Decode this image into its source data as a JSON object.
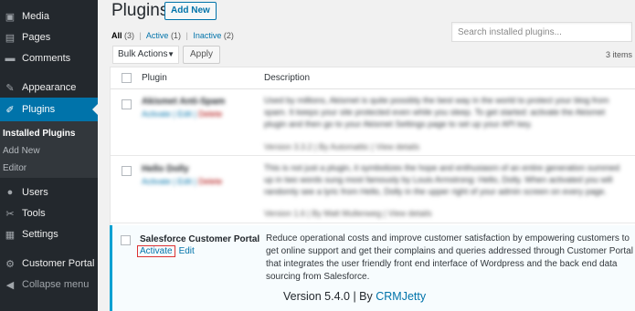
{
  "sidebar": {
    "items": [
      {
        "label": "Media",
        "icon": "media-icon",
        "glyph": "▣"
      },
      {
        "label": "Pages",
        "icon": "pages-icon",
        "glyph": "▤"
      },
      {
        "label": "Comments",
        "icon": "comments-icon",
        "glyph": "▬"
      },
      {
        "label": "Appearance",
        "icon": "appearance-icon",
        "glyph": "✎"
      },
      {
        "label": "Plugins",
        "icon": "plugins-icon",
        "glyph": "✐"
      },
      {
        "label": "Users",
        "icon": "users-icon",
        "glyph": "●"
      },
      {
        "label": "Tools",
        "icon": "tools-icon",
        "glyph": "✂"
      },
      {
        "label": "Settings",
        "icon": "settings-icon",
        "glyph": "▦"
      },
      {
        "label": "Customer Portal",
        "icon": "customer-portal-icon",
        "glyph": "⚙"
      },
      {
        "label": "Collapse menu",
        "icon": "collapse-icon",
        "glyph": "◀"
      }
    ],
    "submenu": [
      "Installed Plugins",
      "Add New",
      "Editor"
    ],
    "active_color": "#0073aa"
  },
  "header": {
    "title": "Plugins",
    "add_new": "Add New"
  },
  "filters": {
    "all": "All",
    "all_count": "(3)",
    "active": "Active",
    "active_count": "(1)",
    "inactive": "Inactive",
    "inactive_count": "(2)",
    "separator": "|"
  },
  "search": {
    "placeholder": "Search installed plugins..."
  },
  "bulk": {
    "label": "Bulk Actions",
    "apply": "Apply"
  },
  "items_count": "3 items",
  "table": {
    "columns": [
      "Plugin",
      "Description"
    ],
    "rows": [
      {
        "name": "Akismet Anti-Spam",
        "actions": [
          "Activate",
          "Edit",
          "Delete"
        ],
        "description": "Used by millions, Akismet is quite possibly the best way in the world to protect your blog from spam. It keeps your site protected even while you sleep. To get started: activate the Akismet plugin and then go to your Akismet Settings page to set up your API key.",
        "version": "Version 3.3.2 | By Automattic | View details"
      },
      {
        "name": "Hello Dolly",
        "actions": [
          "Activate",
          "Edit",
          "Delete"
        ],
        "description": "This is not just a plugin, it symbolizes the hope and enthusiasm of an entire generation summed up in two words sung most famously by Louis Armstrong: Hello, Dolly. When activated you will randomly see a lyric from Hello, Dolly in the upper right of your admin screen on every page.",
        "version": "Version 1.6 | By Matt Mullenweg | View details"
      }
    ],
    "featured": {
      "name": "Salesforce Customer Portal",
      "activate": "Activate",
      "edit": "Edit",
      "description": "Reduce operational costs and improve customer satisfaction by empowering customers to get online support and get their complains and queries addressed through Customer Portal that integrates the user friendly front end interface of Wordpress and the back end data sourcing from Salesforce.",
      "version_prefix": "Version 5.4.0 | By",
      "author": "CRMJetty"
    }
  }
}
